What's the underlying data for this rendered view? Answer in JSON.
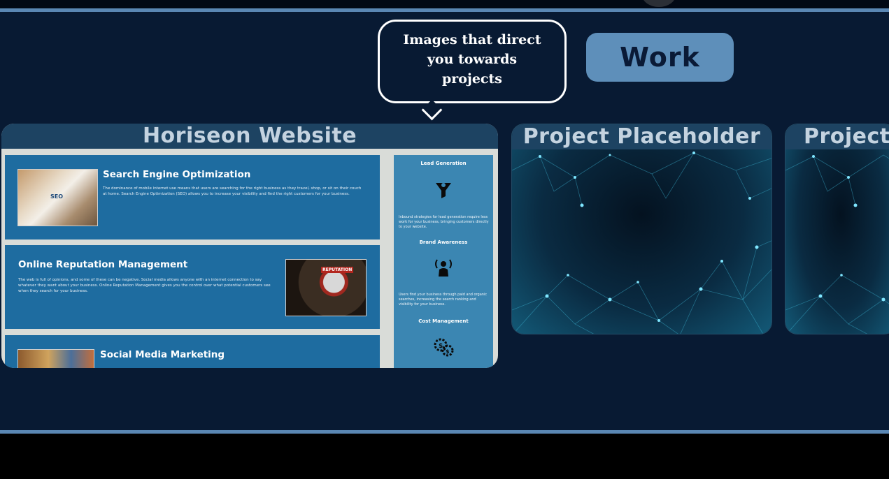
{
  "callout": {
    "text": "Images that direct you towards projects"
  },
  "nav": {
    "work_label": "Work"
  },
  "projects": [
    {
      "title": "Horiseon Website",
      "thumbnail": {
        "blocks": [
          {
            "heading": "Search Engine Optimization",
            "body": "The dominance of mobile internet use means that users are searching for the right business as they travel, shop, or sit on their couch at home. Search Engine Optimization (SEO) allows you to increase your visibility and find the right customers for your business."
          },
          {
            "heading": "Online Reputation Management",
            "body": "The web is full of opinions, and some of these can be negative. Social media allows anyone with an internet connection to say whatever they want about your business. Online Reputation Management gives you the control over what potential customers see when they search for your business."
          },
          {
            "heading": "Social Media Marketing",
            "body": ""
          }
        ],
        "image_labels": {
          "seo": "SEO",
          "reputation": "REPUTATION"
        },
        "sidebar": [
          {
            "heading": "Lead Generation",
            "icon": "funnel-icon",
            "body": "Inbound strategies for lead generation require less work for your business, bringing customers directly to your website."
          },
          {
            "heading": "Brand Awareness",
            "icon": "broadcast-person-icon",
            "body": "Users find your business through paid and organic searches, increasing the search ranking and visibility for your business."
          },
          {
            "heading": "Cost Management",
            "icon": "gears-dollar-icon",
            "body": ""
          }
        ]
      }
    },
    {
      "title": "Project Placeholder"
    },
    {
      "title": "Project"
    }
  ],
  "colors": {
    "page_bg": "#081a33",
    "accent_border": "#5a87b4",
    "work_button": "#5e8fba",
    "card_header": "#1d4362"
  }
}
